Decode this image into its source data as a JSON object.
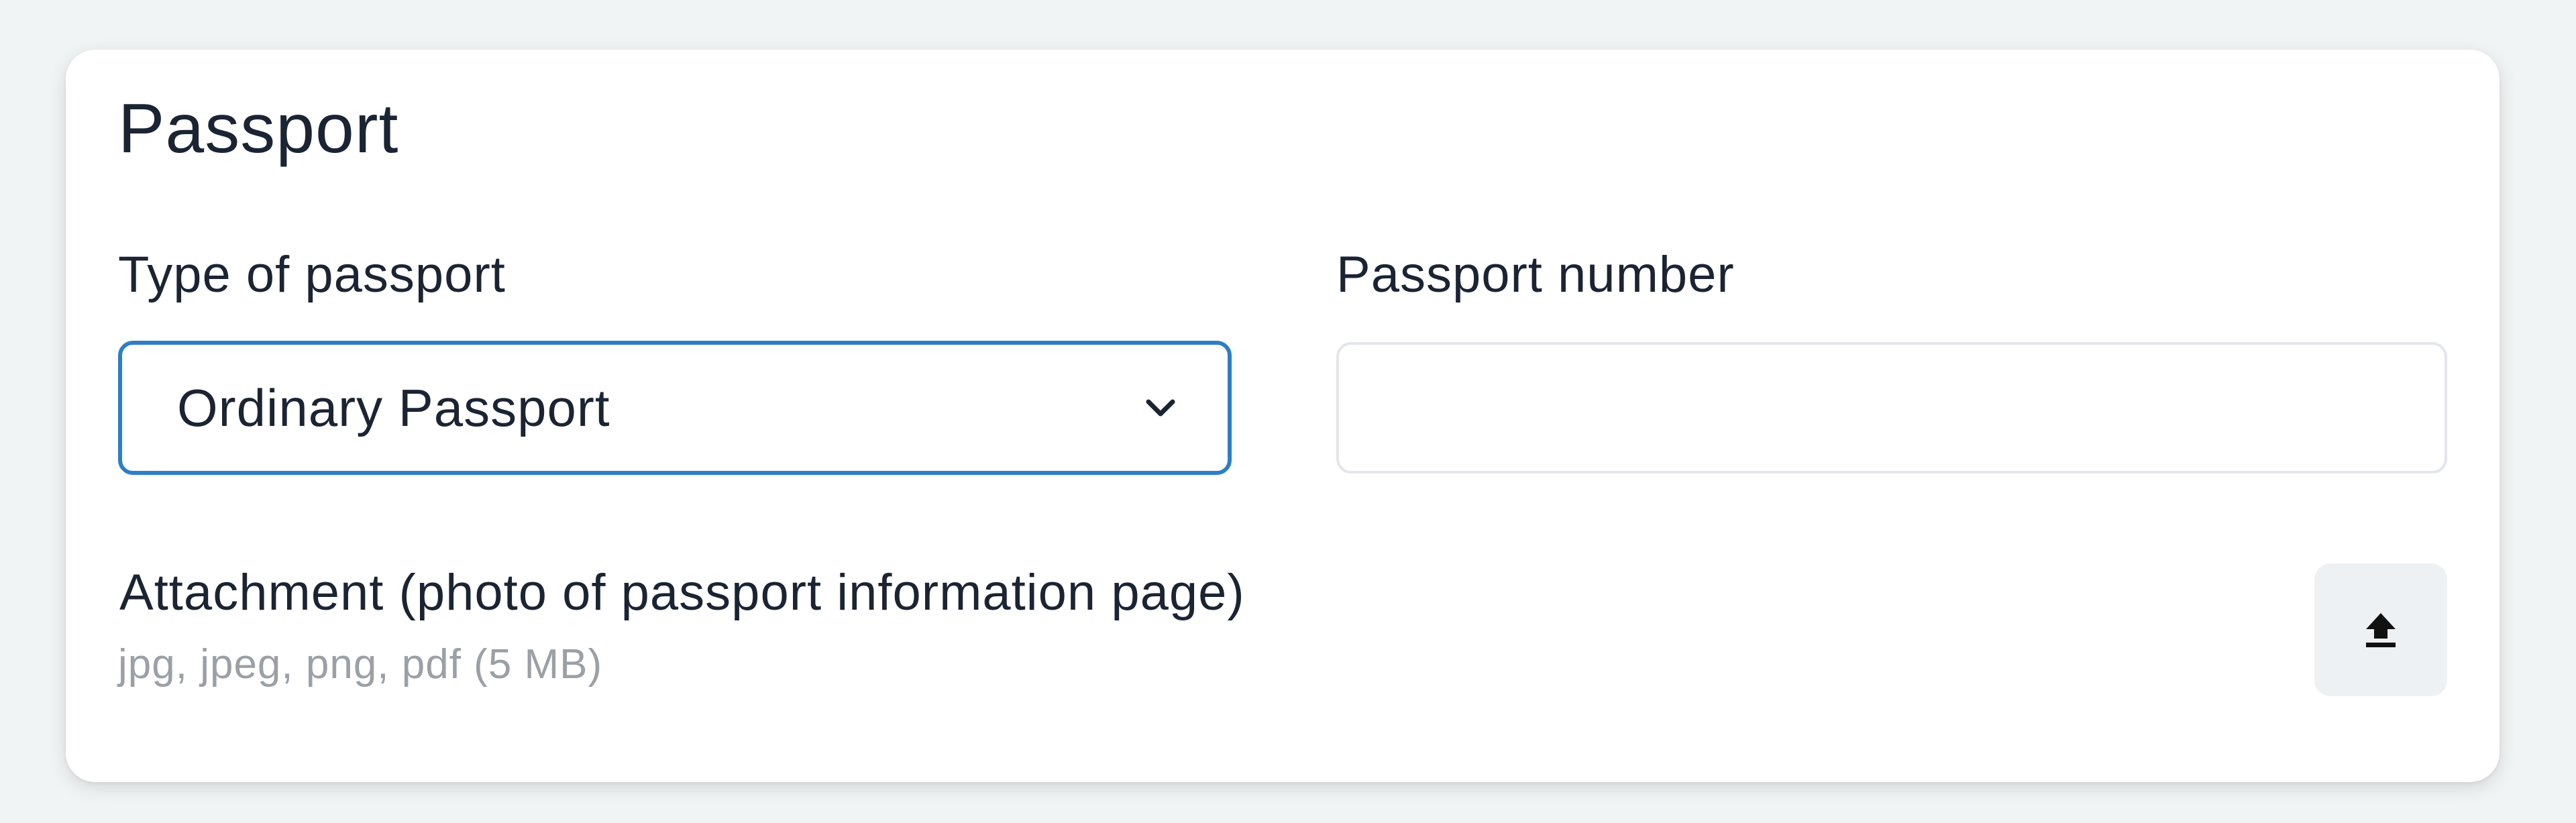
{
  "section": {
    "title": "Passport"
  },
  "passport_type": {
    "label": "Type of passport",
    "selected_value": "Ordinary Passport",
    "icon": "chevron-down-icon"
  },
  "passport_number": {
    "label": "Passport number",
    "value": "",
    "placeholder": ""
  },
  "attachment": {
    "label": "Attachment (photo of passport information page)",
    "hint": "jpg, jpeg, png, pdf (5 MB)",
    "icon": "upload-icon"
  },
  "colors": {
    "focus_border": "#2d7ec6",
    "text": "#1b2433",
    "hint_text": "#9aa0a6",
    "page_background": "#f1f4f5",
    "upload_button_background": "#eef1f4"
  }
}
